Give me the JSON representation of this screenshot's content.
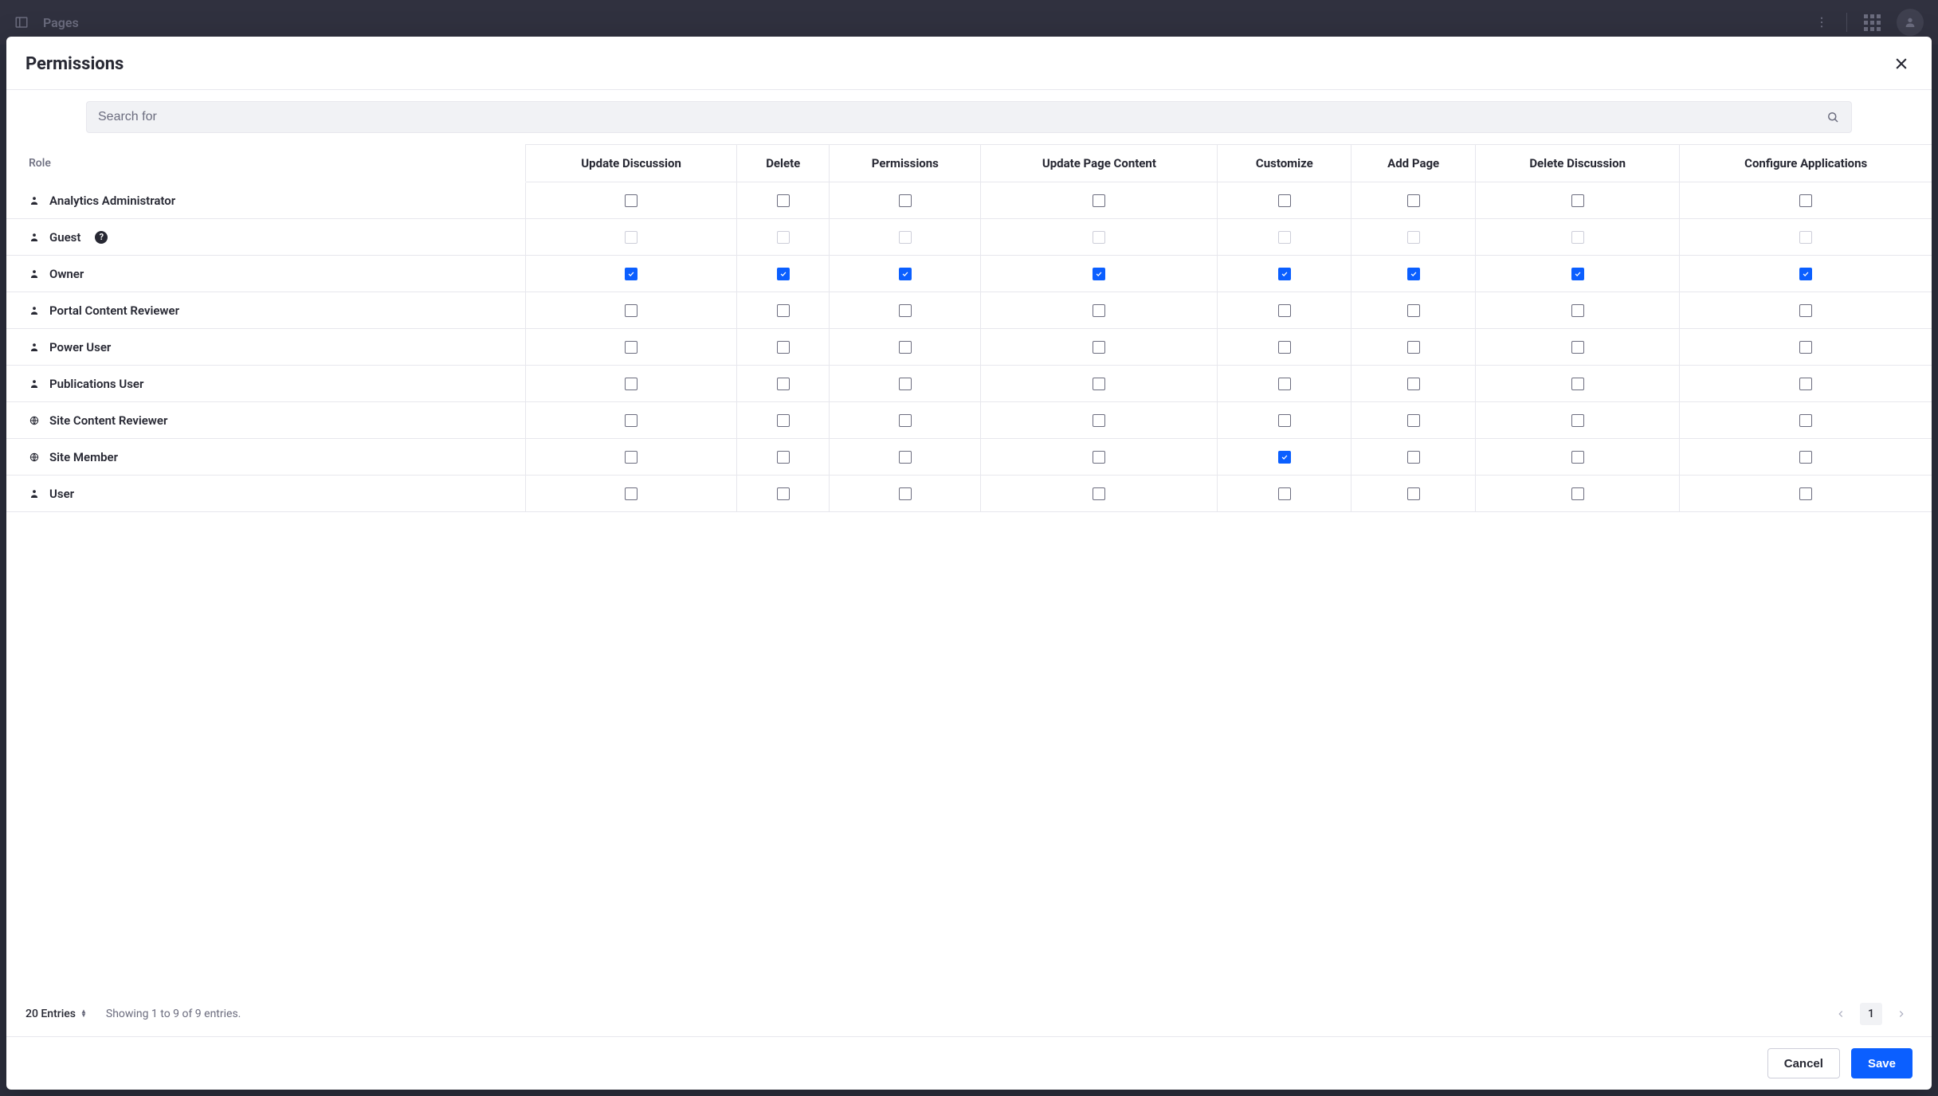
{
  "topbar": {
    "title": "Pages"
  },
  "modal": {
    "title": "Permissions",
    "search_placeholder": "Search for"
  },
  "table": {
    "role_header": "Role",
    "columns": [
      "Update Discussion",
      "Delete",
      "Permissions",
      "Update Page Content",
      "Customize",
      "Add Page",
      "Delete Discussion",
      "Configure Applications"
    ],
    "rows": [
      {
        "name": "Analytics Administrator",
        "icon": "user",
        "help": false,
        "disabled": false,
        "perms": [
          false,
          false,
          false,
          false,
          false,
          false,
          false,
          false
        ]
      },
      {
        "name": "Guest",
        "icon": "user",
        "help": true,
        "disabled": true,
        "perms": [
          false,
          false,
          false,
          false,
          false,
          false,
          false,
          false
        ]
      },
      {
        "name": "Owner",
        "icon": "user",
        "help": false,
        "disabled": false,
        "perms": [
          true,
          true,
          true,
          true,
          true,
          true,
          true,
          true
        ]
      },
      {
        "name": "Portal Content Reviewer",
        "icon": "user",
        "help": false,
        "disabled": false,
        "perms": [
          false,
          false,
          false,
          false,
          false,
          false,
          false,
          false
        ]
      },
      {
        "name": "Power User",
        "icon": "user",
        "help": false,
        "disabled": false,
        "perms": [
          false,
          false,
          false,
          false,
          false,
          false,
          false,
          false
        ]
      },
      {
        "name": "Publications User",
        "icon": "user",
        "help": false,
        "disabled": false,
        "perms": [
          false,
          false,
          false,
          false,
          false,
          false,
          false,
          false
        ]
      },
      {
        "name": "Site Content Reviewer",
        "icon": "globe",
        "help": false,
        "disabled": false,
        "perms": [
          false,
          false,
          false,
          false,
          false,
          false,
          false,
          false
        ]
      },
      {
        "name": "Site Member",
        "icon": "globe",
        "help": false,
        "disabled": false,
        "perms": [
          false,
          false,
          false,
          false,
          true,
          false,
          false,
          false
        ]
      },
      {
        "name": "User",
        "icon": "user",
        "help": false,
        "disabled": false,
        "perms": [
          false,
          false,
          false,
          false,
          false,
          false,
          false,
          false
        ]
      }
    ]
  },
  "pager": {
    "entries_label": "20 Entries",
    "showing": "Showing 1 to 9 of 9 entries.",
    "page": "1"
  },
  "footer": {
    "cancel": "Cancel",
    "save": "Save"
  }
}
